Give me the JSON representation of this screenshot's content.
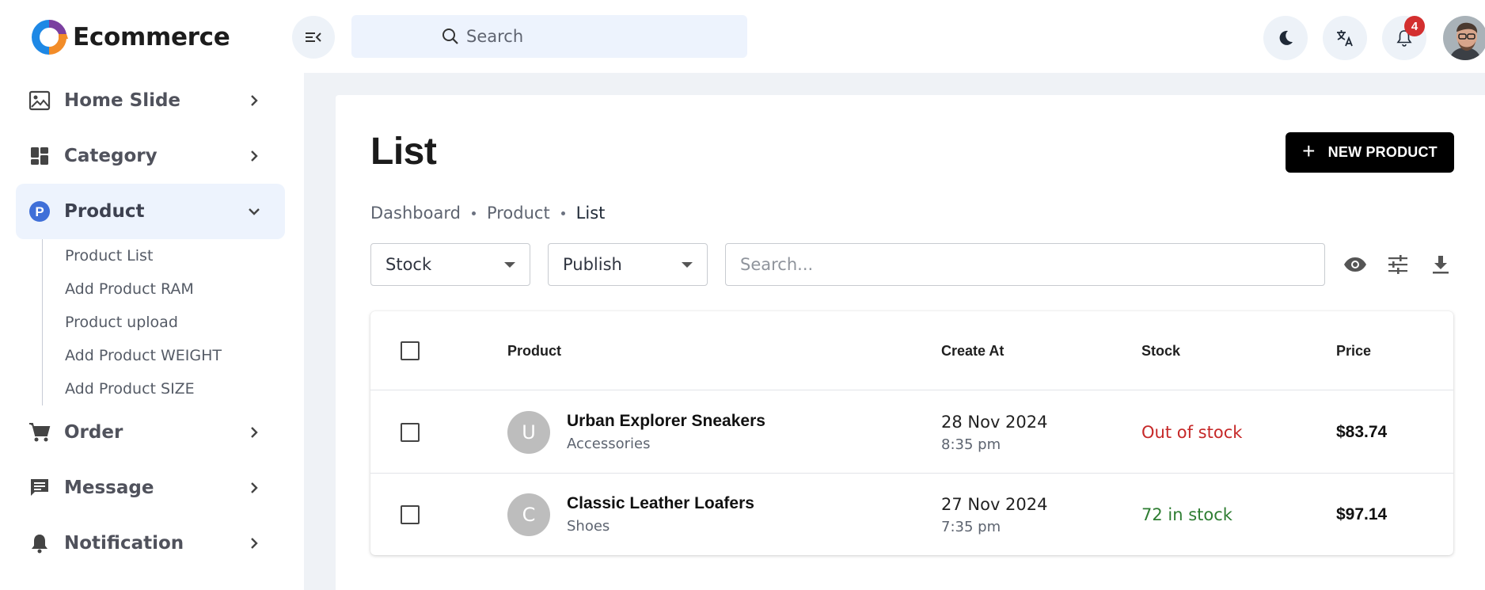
{
  "brand": {
    "name": "Ecommerce"
  },
  "topbar": {
    "search_placeholder": "Search",
    "notification_count": "4"
  },
  "sidebar": {
    "items": [
      {
        "label": "Home Slide",
        "icon": "image-icon"
      },
      {
        "label": "Category",
        "icon": "dashboard-icon"
      },
      {
        "label": "Product",
        "icon": "product-p-icon",
        "active": true
      },
      {
        "label": "Order",
        "icon": "cart-icon"
      },
      {
        "label": "Message",
        "icon": "chat-icon"
      },
      {
        "label": "Notification",
        "icon": "bell-icon"
      }
    ],
    "product_sub": [
      "Product List",
      "Add Product RAM",
      "Product upload",
      "Add Product WEIGHT",
      "Add Product SIZE"
    ]
  },
  "page": {
    "title": "List",
    "new_button": "NEW PRODUCT",
    "breadcrumb": [
      "Dashboard",
      "Product",
      "List"
    ]
  },
  "filters": {
    "stock": "Stock",
    "publish": "Publish",
    "search_placeholder": "Search..."
  },
  "table": {
    "headers": {
      "product": "Product",
      "created": "Create At",
      "stock": "Stock",
      "price": "Price"
    },
    "rows": [
      {
        "initial": "U",
        "name": "Urban Explorer Sneakers",
        "category": "Accessories",
        "date": "28 Nov 2024",
        "time": "8:35 pm",
        "stock": "Out of stock",
        "stock_color": "#c62828",
        "price": "$83.74"
      },
      {
        "initial": "C",
        "name": "Classic Leather Loafers",
        "category": "Shoes",
        "date": "27 Nov 2024",
        "time": "7:35 pm",
        "stock": "72 in stock",
        "stock_color": "#2e7d32",
        "price": "$97.14"
      }
    ]
  },
  "colors": {
    "accent_blue": "#3f6fd8",
    "active_bg": "#edf3fd",
    "badge_red": "#d32f2f"
  }
}
